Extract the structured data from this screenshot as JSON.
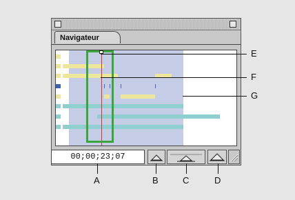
{
  "panel": {
    "tab_label": "Navigateur",
    "timecode": "00;00;23;07"
  },
  "callouts": {
    "A": "A",
    "B": "B",
    "C": "C",
    "D": "D",
    "E": "E",
    "F": "F",
    "G": "G"
  },
  "icons": {
    "zoom_out": "zoom-out-mountain-icon",
    "zoom_slider": "zoom-slider-icon",
    "zoom_in": "zoom-in-mountain-icon",
    "resize": "resize-grip-icon"
  },
  "colors": {
    "view_box": "#3aa53a",
    "current_time": "#d93030",
    "visible_area": "#c4cce6"
  }
}
